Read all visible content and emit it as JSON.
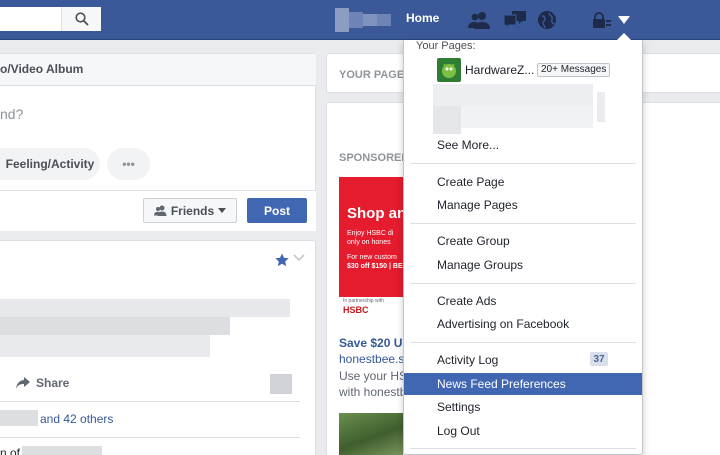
{
  "topbar": {
    "home_label": "Home"
  },
  "composer": {
    "tab_label": "o/Video Album",
    "prompt": "nd?",
    "feeling_label": "Feeling/Activity",
    "more_label": "•••",
    "audience_label": "Friends",
    "post_label": "Post"
  },
  "story": {
    "share_label": "Share",
    "likes_suffix": "and 42 others",
    "comment_partial": "n of"
  },
  "right_column": {
    "your_pages_label": "YOUR PAGES",
    "sponsored_label": "SPONSORED",
    "ad_headline": "Shop an",
    "ad_line1": "Enjoy HSBC di",
    "ad_line2": "only on hones",
    "ad_line3": "For new custom",
    "ad_line4": "$30 off $150 | BE",
    "ad_partner": "In partnership with",
    "ad_bank": "HSBC",
    "ad_title": "Save $20 U",
    "ad_link": "honestbee.s",
    "ad_desc": "Use your HS with honestb"
  },
  "menu": {
    "header": "Your Pages:",
    "page_name": "HardwareZ...",
    "page_badge": "20+ Messages",
    "see_more": "See More...",
    "create_page": "Create Page",
    "manage_pages": "Manage Pages",
    "create_group": "Create Group",
    "manage_groups": "Manage Groups",
    "create_ads": "Create Ads",
    "advertising": "Advertising on Facebook",
    "activity_log": "Activity Log",
    "activity_count": "37",
    "news_feed_prefs": "News Feed Preferences",
    "settings": "Settings",
    "log_out": "Log Out"
  },
  "colors": {
    "topbar": "#3b5998",
    "accent": "#4267b2",
    "link": "#365899",
    "ad_red": "#e41c2d"
  }
}
